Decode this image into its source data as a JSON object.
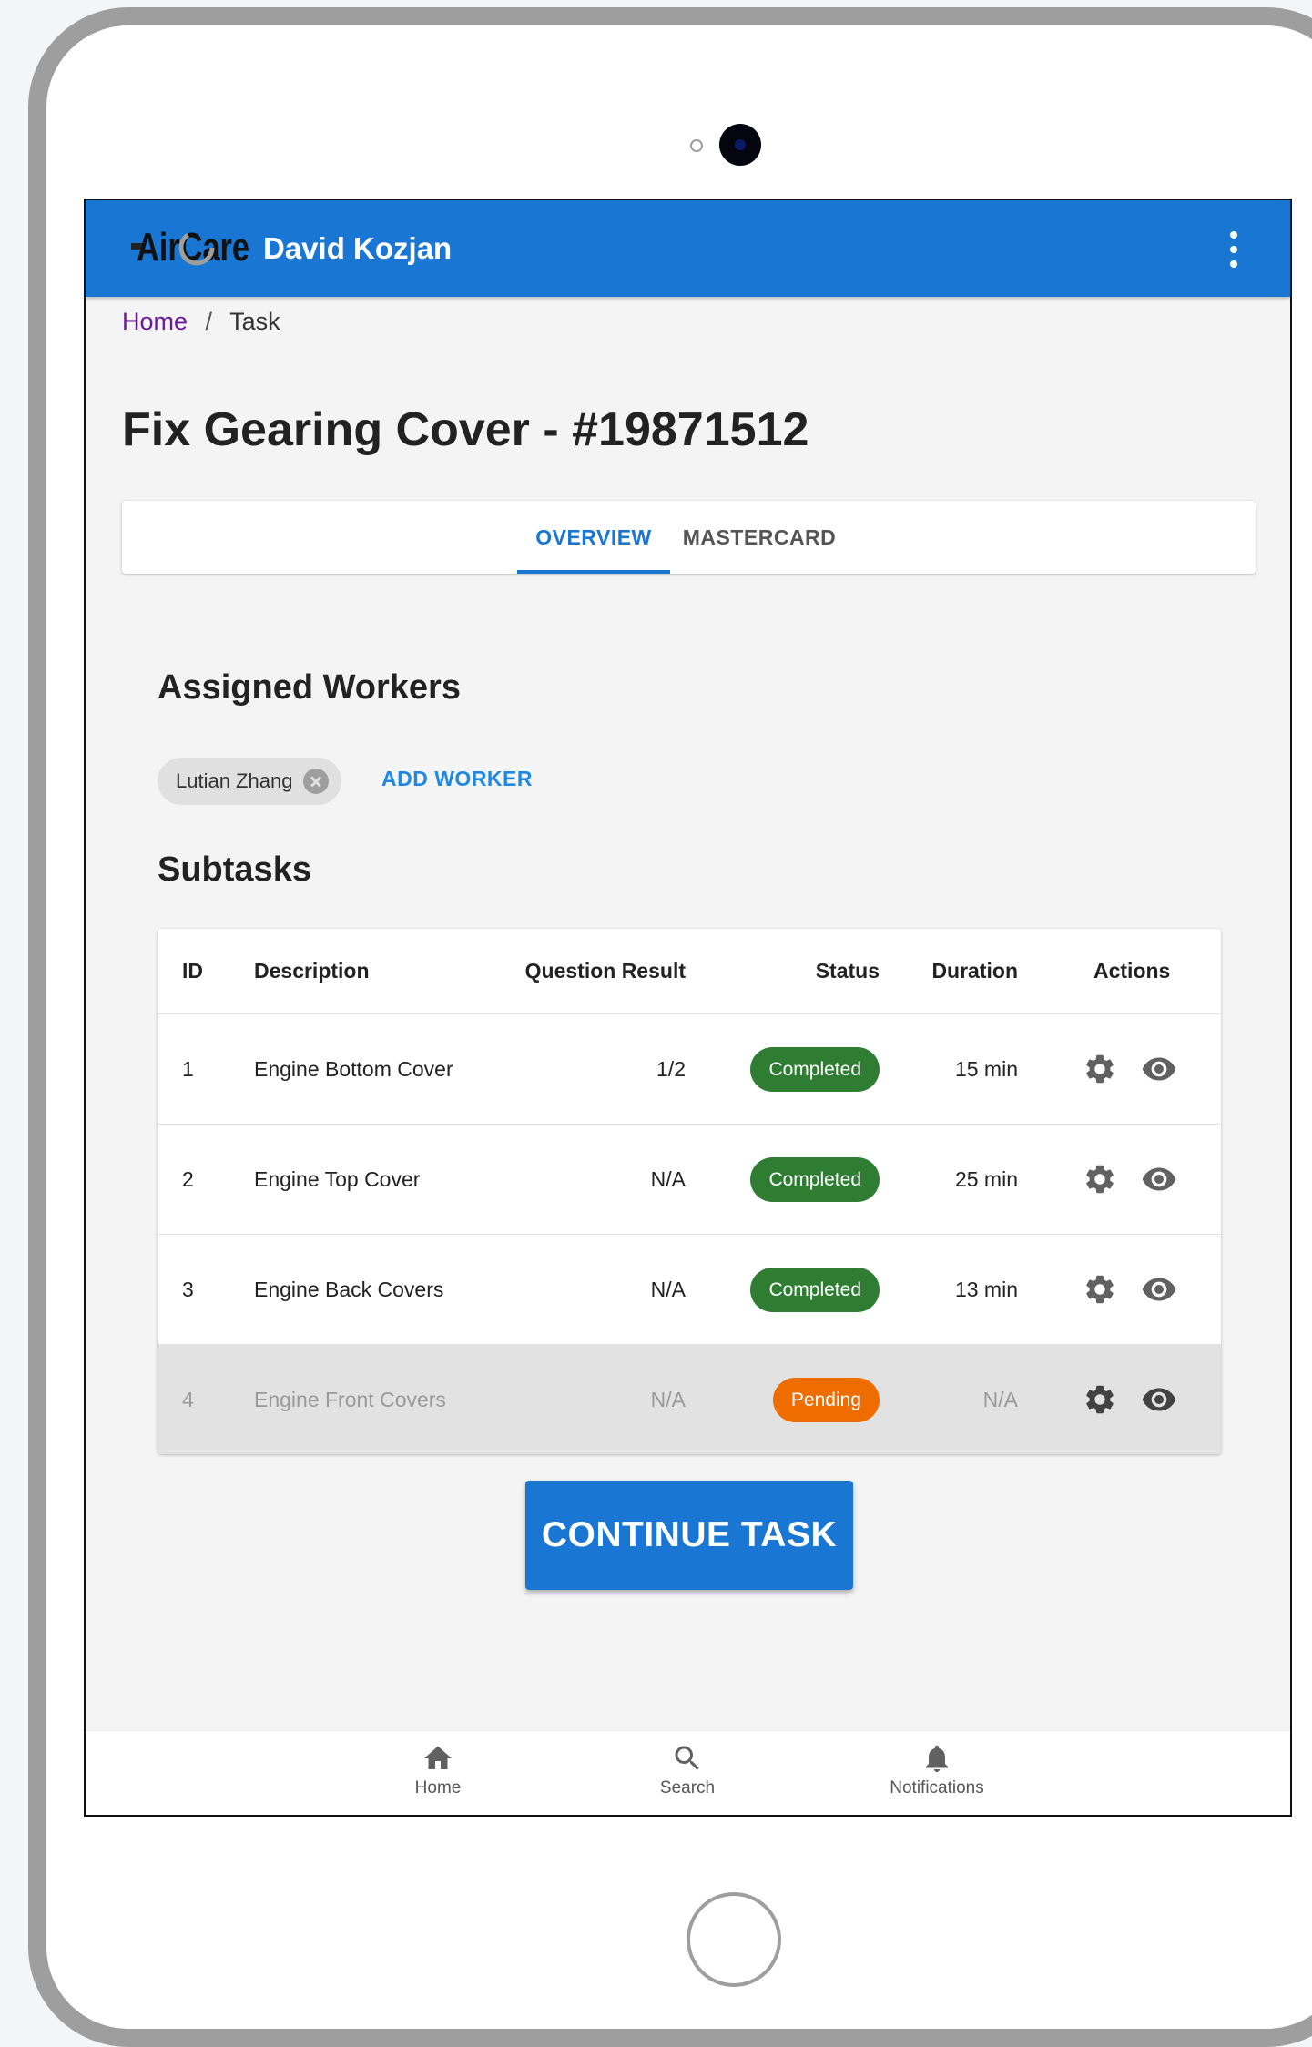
{
  "app": {
    "brand": "AirCare",
    "user_name": "David Kozjan"
  },
  "breadcrumb": {
    "home": "Home",
    "separator": "/",
    "current": "Task"
  },
  "page": {
    "title": "Fix Gearing Cover - #19871512"
  },
  "tabs": [
    {
      "label": "OVERVIEW",
      "active": true
    },
    {
      "label": "MASTERCARD",
      "active": false
    }
  ],
  "workers": {
    "heading": "Assigned Workers",
    "chips": [
      "Lutian Zhang"
    ],
    "add_label": "ADD WORKER"
  },
  "subtasks": {
    "heading": "Subtasks",
    "columns": [
      "ID",
      "Description",
      "Question Result",
      "Status",
      "Duration",
      "Actions"
    ],
    "rows": [
      {
        "id": "1",
        "description": "Engine Bottom Cover",
        "question_result": "1/2",
        "status": "Completed",
        "duration": "15 min",
        "status_color": "#2e7d32"
      },
      {
        "id": "2",
        "description": "Engine Top Cover",
        "question_result": "N/A",
        "status": "Completed",
        "duration": "25 min",
        "status_color": "#2e7d32"
      },
      {
        "id": "3",
        "description": "Engine Back Covers",
        "question_result": "N/A",
        "status": "Completed",
        "duration": "13 min",
        "status_color": "#2e7d32"
      },
      {
        "id": "4",
        "description": "Engine Front Covers",
        "question_result": "N/A",
        "status": "Pending",
        "duration": "N/A",
        "status_color": "#ef6c00"
      }
    ],
    "row_actions": [
      "gear-icon",
      "eye-icon"
    ]
  },
  "continue_button": "CONTINUE TASK",
  "bottom_nav": [
    {
      "label": "Home",
      "icon": "home-icon"
    },
    {
      "label": "Search",
      "icon": "search-icon"
    },
    {
      "label": "Notifications",
      "icon": "bell-icon"
    }
  ],
  "colors": {
    "primary": "#1976d2",
    "completed": "#2e7d32",
    "pending": "#ef6c00",
    "link_visited": "#6a1b9a"
  }
}
